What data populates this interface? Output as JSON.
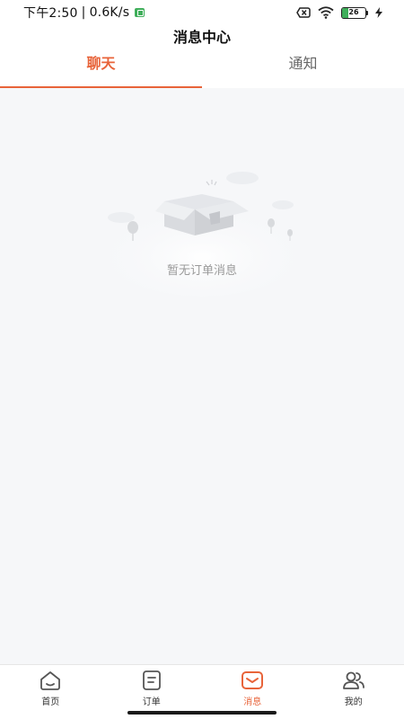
{
  "status_bar": {
    "time": "下午2:50",
    "separator": "|",
    "speed": "0.6K/s",
    "battery": "26"
  },
  "header": {
    "title": "消息中心"
  },
  "tabs": [
    {
      "label": "聊天",
      "active": true
    },
    {
      "label": "通知",
      "active": false
    }
  ],
  "empty_state": {
    "text": "暂无订单消息",
    "illustration": "empty-box-illustration"
  },
  "bottom_nav": [
    {
      "label": "首页",
      "icon": "home-icon",
      "active": false
    },
    {
      "label": "订单",
      "icon": "order-icon",
      "active": false
    },
    {
      "label": "消息",
      "icon": "message-icon",
      "active": true
    },
    {
      "label": "我的",
      "icon": "profile-icon",
      "active": false
    }
  ],
  "colors": {
    "accent": "#e8643a",
    "background": "#f6f7f9"
  }
}
